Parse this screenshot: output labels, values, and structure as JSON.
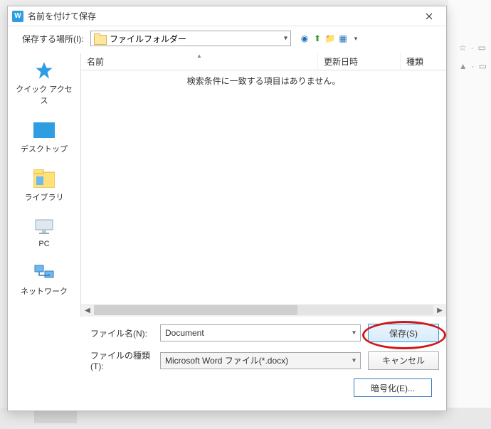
{
  "dialog": {
    "title": "名前を付けて保存",
    "location_label": "保存する場所(I):",
    "location_value": "ファイルフォルダー",
    "headers": {
      "name": "名前",
      "date": "更新日時",
      "type": "種類"
    },
    "empty_message": "検索条件に一致する項目はありません。",
    "filename_label": "ファイル名(N):",
    "filename_value": "Document",
    "filetype_label": "ファイルの種類(T):",
    "filetype_value": "Microsoft Word ファイル(*.docx)",
    "save_btn": "保存(S)",
    "cancel_btn": "キャンセル",
    "encrypt_btn": "暗号化(E)..."
  },
  "places": [
    {
      "label": "クイック アクセス"
    },
    {
      "label": "デスクトップ"
    },
    {
      "label": "ライブラリ"
    },
    {
      "label": "PC"
    },
    {
      "label": "ネットワーク"
    }
  ]
}
